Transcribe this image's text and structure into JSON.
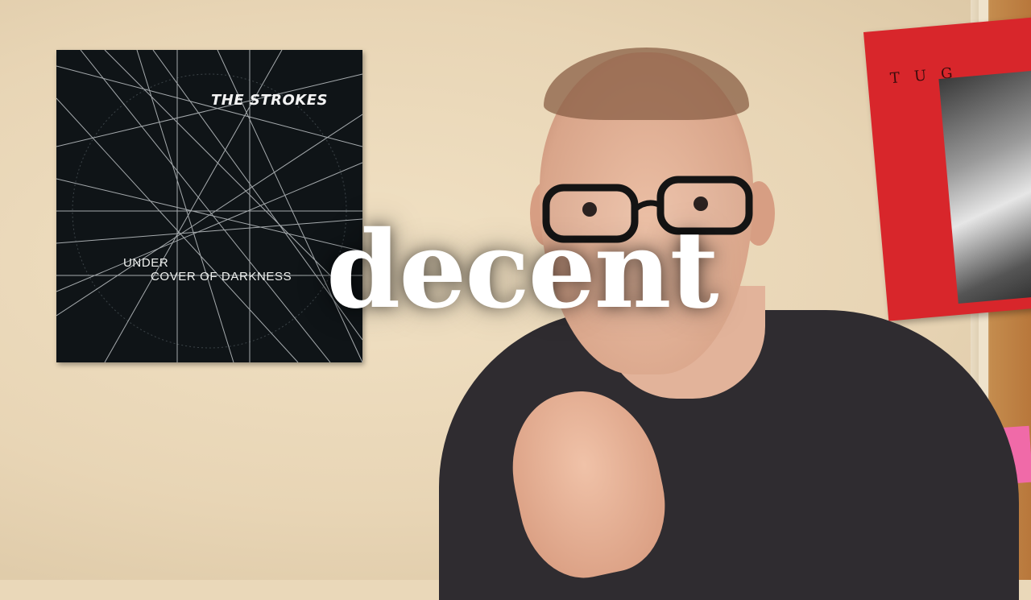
{
  "overlay": {
    "caption": "decent"
  },
  "album": {
    "artist": "THE STROKES",
    "title_line1": "UNDER",
    "title_line2": "COVER OF DARKNESS"
  },
  "poster": {
    "letters": "TUG"
  },
  "colors": {
    "wall": "#ead8b9",
    "album_bg": "#0f1417",
    "poster_red": "#d8262b",
    "shirt": "#2f2c30",
    "caption_text": "#ffffff"
  }
}
